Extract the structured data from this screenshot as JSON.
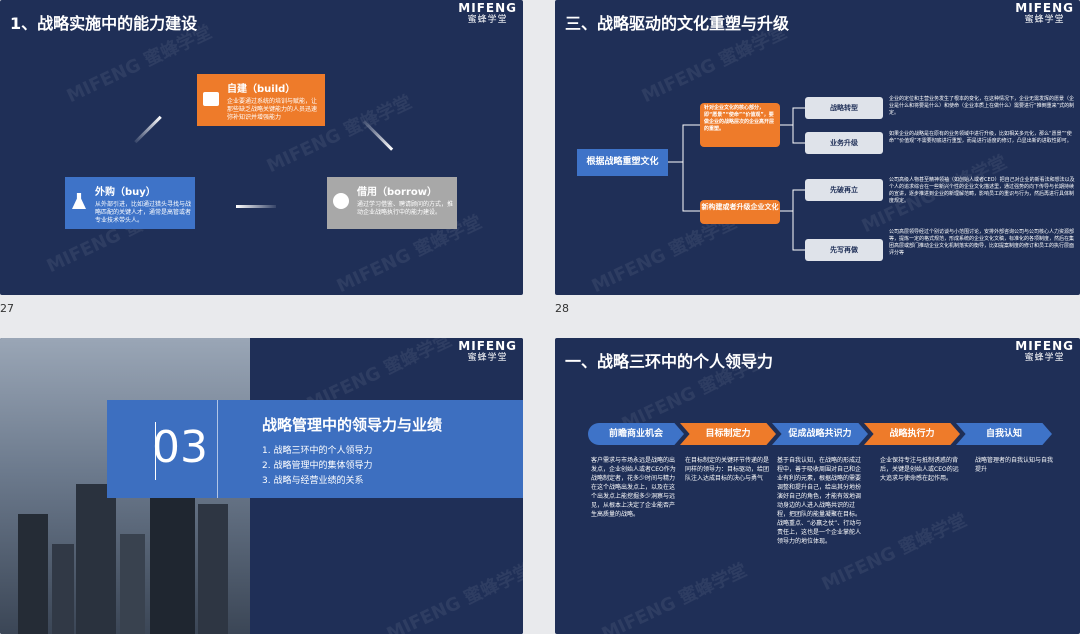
{
  "slide1": {
    "title": "1、战略实施中的能力建设",
    "logo_en": "MIFENG",
    "logo_cn": "蜜蜂学堂",
    "build": {
      "title": "自建（build）",
      "desc": "企业要通过系统的培训与赋能，让那些缺乏战略关键能力的人员迅速弥补知识并增强能力"
    },
    "borrow": {
      "title": "借用（borrow）",
      "desc": "通过学习借鉴、聘请顾问的方式，推动企业战略执行中的能力建设。"
    },
    "buy": {
      "title": "外购（buy）",
      "desc": "从外部引进，比如通过猎头寻找与战略匹配的关键人才，通常是高管或者专业技术带头人。"
    },
    "watermark": "MIFENG 蜜蜂学堂",
    "page_num": "27"
  },
  "slide2": {
    "title": "三、战略驱动的文化重塑与升级",
    "logo_en": "MIFENG",
    "logo_cn": "蜜蜂学堂",
    "root": "根据战略重塑文化",
    "branch1": "针对企业文化的核心部分，即“愿景”“使命”“价值观”，要做企业的战略层次的企业高开层的重塑。",
    "branch2": "新构建或者升级企业文化",
    "caps": [
      "战略转型",
      "业务升级",
      "先破再立",
      "先写再做"
    ],
    "descs": [
      "企业的定位和主营业务发生了根本的变化，在这种情况下，企业无需发挥的愿景（企业是什么和将要是什么）和使命（企业本质上在做什么）需要进行“推倒重来”式的制定。",
      "如果企业的战略是在原有的业务领域中进行升级，比如相关多元化，那么“愿景”“使命”“价值观”不需要彻底进行重塑，而是进行适度的修订，凸显出新的进取性即可。",
      "公司高级人物甚至精神领袖（如创始人或者CEO）把自己对企业的新看法和想法以及个人的追求综合在一些新兴个性的企业文化描述里，通过强势的向下传导与长期持续的宣讲，逐步推进到企业的新理解范畴，影响员工的重识与行为，然后再进行具体制度规定。",
      "公司高层领导经过个别访谈与小范围讨论，安排外部咨询公司与公司核心人力资源部等，提炼一定的格式规范，形成系统的企业文化文稿，标准化的各项制度，然后在集团高层或部门推动企业文化机制落实的衡导，比如提案制度的修订和员工的执行层面评分等"
    ],
    "page_num": "28"
  },
  "slide3": {
    "number": "03",
    "title": "战略管理中的领导力与业绩",
    "logo_en": "MIFENG",
    "logo_cn": "蜜蜂学堂",
    "items": [
      "1. 战略三环中的个人领导力",
      "2. 战略管理中的集体领导力",
      "3. 战略与经营业绩的关系"
    ]
  },
  "slide4": {
    "title": "一、战略三环中的个人领导力",
    "logo_en": "MIFENG",
    "logo_cn": "蜜蜂学堂",
    "steps": [
      "前瞻商业机会",
      "目标制定力",
      "促成战略共识力",
      "战略执行力",
      "自我认知"
    ],
    "texts": [
      "客户需求与市场永远是战略的出发点，企业创始人或者CEO作为战略制定者，花多少时间与精力在这个战略出发点上，以及在这个出发点上能挖掘多少洞察与远见，从根本上决定了企业能否产生高质量的战略。",
      "在目标制定的关键环节传递的是同样的领导力：目标驱动，给团队注入达成目标的决心与勇气",
      "基于自我认知，在战略的形成过程中，善于吸收周围对自己和企业有利的元素，根据战略的需要调整和提升自己，给出其分地扮演好自己的角色，才能有效地调动身边的人进入战略共识的过程，把团队的能量凝聚在目标。战略重点、“必赢之仗”、行动与责任上，这也是一个企业掌舵人领导力的地位体现。",
      "企业保持专注与抵制诱惑的背后，关键是创始人或CEO的远大追求与使命感在起作用。",
      "战略管理者的自我认知与自我提升"
    ]
  }
}
